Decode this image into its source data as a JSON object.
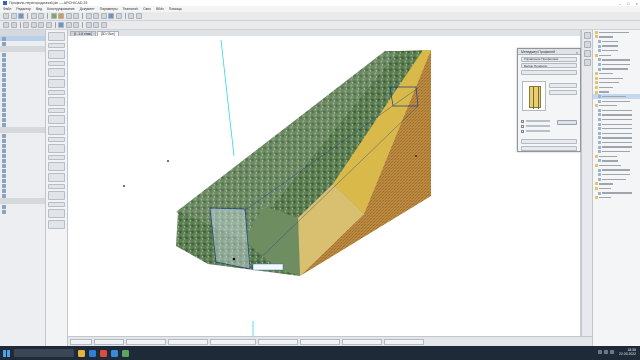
{
  "window": {
    "title": "Профиль перегородочной.pln — ARCHICAD 25"
  },
  "menu": {
    "items": [
      "Файл",
      "Редактор",
      "Вид",
      "Конструирование",
      "Документ",
      "Параметры",
      "Teamwork",
      "Окно",
      "BIMx",
      "Помощь"
    ]
  },
  "viewport": {
    "tabs": [
      {
        "label": "[1. 1-й этаж]",
        "active": false
      },
      {
        "label": "[3D / Все]",
        "active": true
      }
    ]
  },
  "palette": {
    "title": "Менеджер Профилей",
    "sections": [
      "Управление Профилями",
      "Выбор Профиля"
    ],
    "apply_label": "Применить"
  },
  "taskbar": {
    "time": "18:58",
    "date": "22.03.2022"
  },
  "colors": {
    "wall_fill": "#5b7d52",
    "profile_edge": "#d9b94a",
    "accent_blue": "#2e6ab3",
    "selection_cyan": "#36d3e6"
  }
}
